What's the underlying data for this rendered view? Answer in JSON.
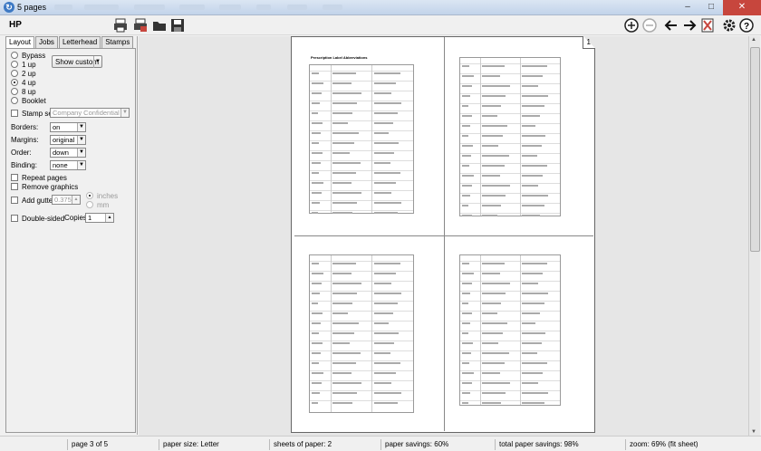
{
  "window": {
    "title": "5 pages"
  },
  "toolbar": {
    "printer": "HP"
  },
  "tabs": [
    "Layout",
    "Jobs",
    "Letterhead",
    "Stamps"
  ],
  "layout": {
    "modes": [
      "Bypass",
      "1 up",
      "2 up",
      "4 up",
      "8 up",
      "Booklet"
    ],
    "selected_mode": "4 up",
    "show_custom_label": "Show custom",
    "stamp_set_label": "Stamp set",
    "stamp_set_value": "Company Confidential",
    "borders_label": "Borders:",
    "borders_value": "on",
    "margins_label": "Margins:",
    "margins_value": "original",
    "order_label": "Order:",
    "order_value": "down",
    "binding_label": "Binding:",
    "binding_value": "none",
    "repeat_pages_label": "Repeat pages",
    "remove_graphics_label": "Remove graphics",
    "add_gutters_label": "Add gutters",
    "gutter_value": "0.375",
    "inches_label": "inches",
    "mm_label": "mm",
    "double_sided_label": "Double-sided",
    "copies_label": "Copies:",
    "copies_value": "1"
  },
  "preview": {
    "sheet_number": "1",
    "page1_heading": "Prescription Label Abbreviations"
  },
  "status": {
    "page": "page 3 of 5",
    "paper_size": "paper size: Letter",
    "sheets": "sheets of paper: 2",
    "savings": "paper savings: 60%",
    "total_savings": "total paper savings: 98%",
    "zoom": "zoom: 69% (fit sheet)"
  },
  "colors": {
    "accent": "#3d79c4",
    "close": "#c7463d"
  }
}
